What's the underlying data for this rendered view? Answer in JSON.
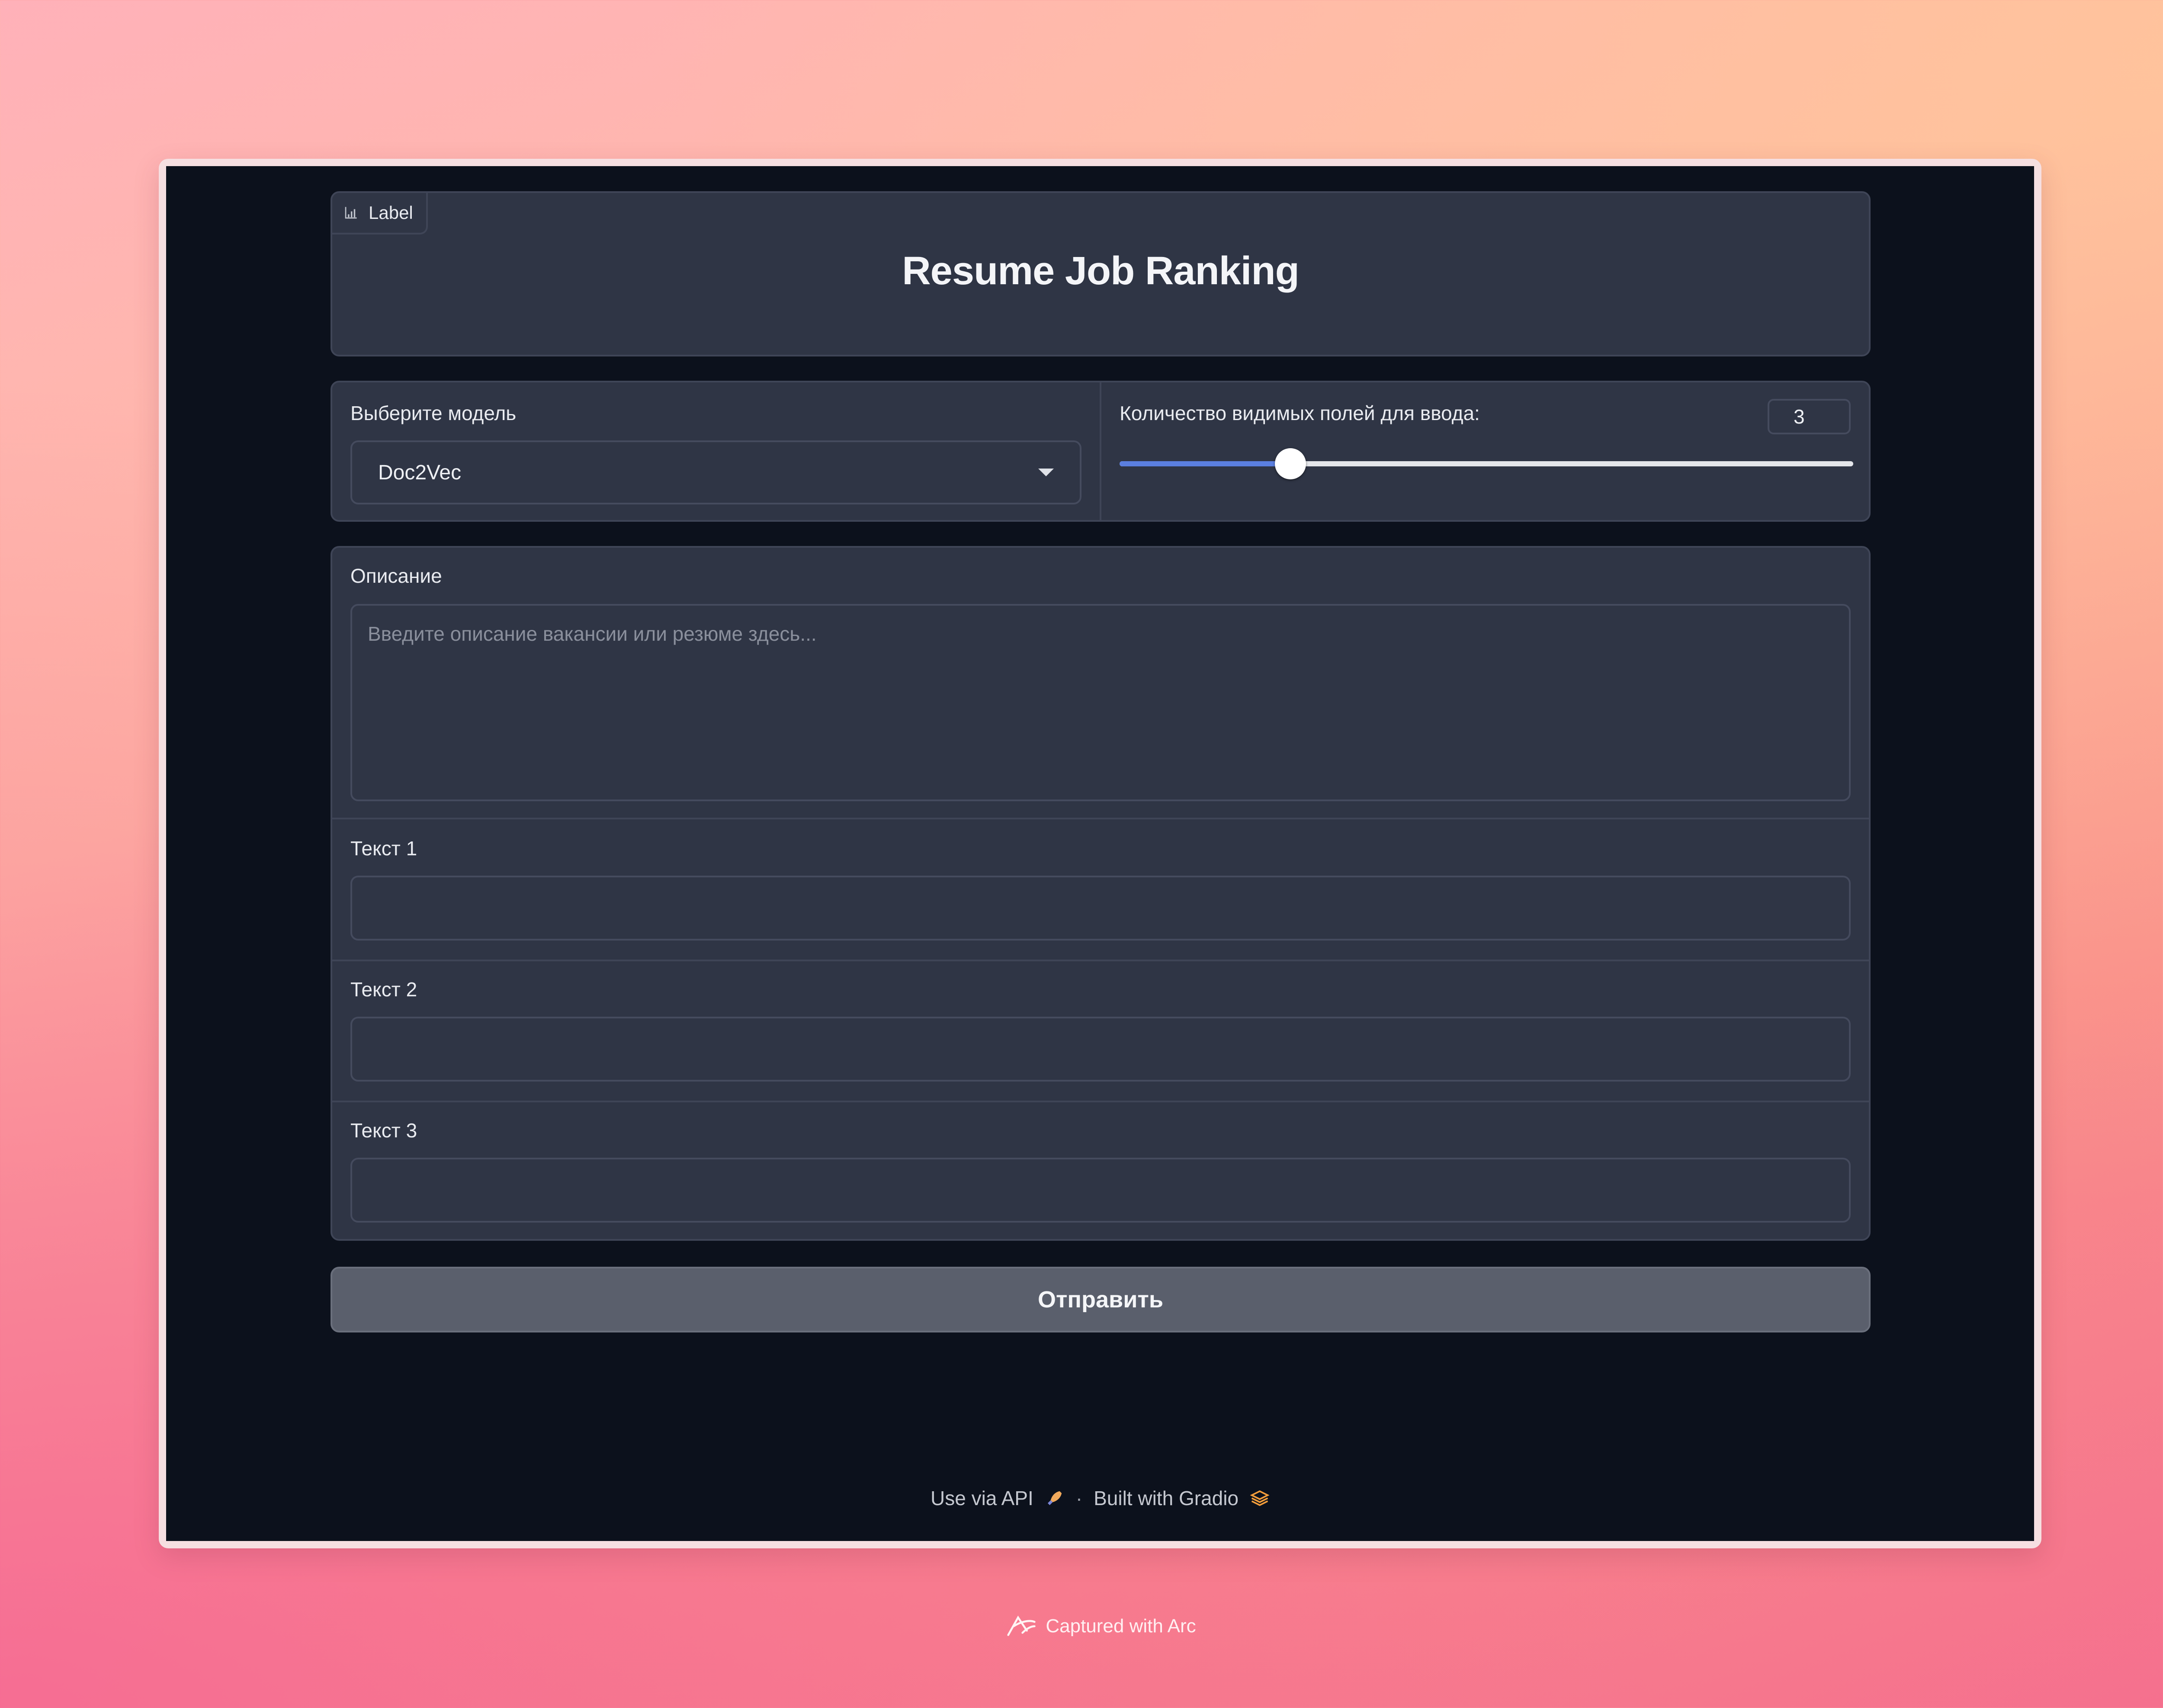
{
  "header": {
    "chip_label": "Label",
    "title": "Resume Job Ranking"
  },
  "model_select": {
    "label": "Выберите модель",
    "value": "Doc2Vec"
  },
  "slider": {
    "label": "Количество видимых полей для ввода:",
    "value": "3",
    "fraction": 0.233
  },
  "description": {
    "label": "Описание",
    "placeholder": "Введите описание вакансии или резюме здесь..."
  },
  "texts": [
    {
      "label": "Текст 1",
      "value": ""
    },
    {
      "label": "Текст 2",
      "value": ""
    },
    {
      "label": "Текст 3",
      "value": ""
    }
  ],
  "submit_label": "Отправить",
  "footer": {
    "api_label": "Use via API",
    "separator": "·",
    "built_label": "Built with Gradio"
  },
  "capture_caption": "Captured with Arc",
  "colors": {
    "accent": "#5b7fe0",
    "panel": "#2f3545",
    "app_bg": "#0c111c"
  }
}
